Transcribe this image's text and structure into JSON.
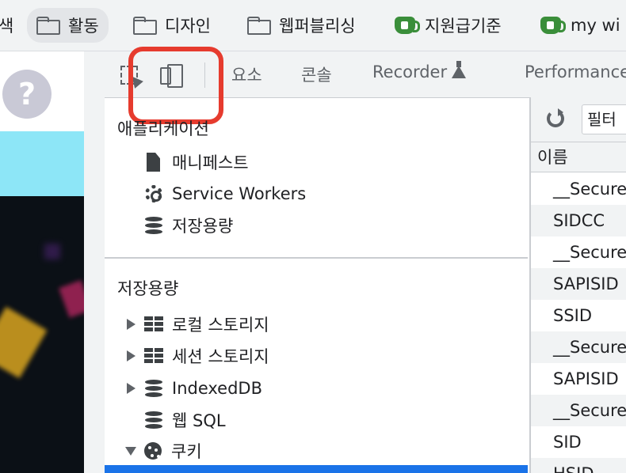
{
  "bookmarks": [
    {
      "label": "색",
      "icon": "none"
    },
    {
      "label": "활동",
      "icon": "folder-icon",
      "active": true
    },
    {
      "label": "디자인",
      "icon": "folder-icon"
    },
    {
      "label": "웹퍼블리싱",
      "icon": "folder-icon"
    },
    {
      "label": "지원급기준",
      "icon": "coffee-cup-icon"
    },
    {
      "label": "my wi",
      "icon": "coffee-cup-icon"
    }
  ],
  "page": {
    "help_symbol": "?"
  },
  "devtools": {
    "tabs": {
      "elements": "요소",
      "console": "콘솔",
      "recorder": "Recorder",
      "performance": "Performance"
    },
    "sidebar": {
      "application_section": "애플리케이션",
      "application_items": [
        "매니페스트",
        "Service Workers",
        "저장용량"
      ],
      "storage_section": "저장용량",
      "storage_items": [
        "로컬 스토리지",
        "세션 스토리지",
        "IndexedDB",
        "웹 SQL",
        "쿠키"
      ]
    },
    "cookies_panel": {
      "filter_placeholder": "필터",
      "column_name": "이름",
      "rows": [
        "__Secure",
        "SIDCC",
        "__Secure",
        "SAPISID",
        "SSID",
        "__Secure",
        "SAPISID",
        "__Secure",
        "SID",
        "HSID"
      ]
    }
  },
  "colors": {
    "highlight_border": "#e63b2e",
    "selection": "#1a73e8",
    "page_cyan": "#8de6f7"
  }
}
